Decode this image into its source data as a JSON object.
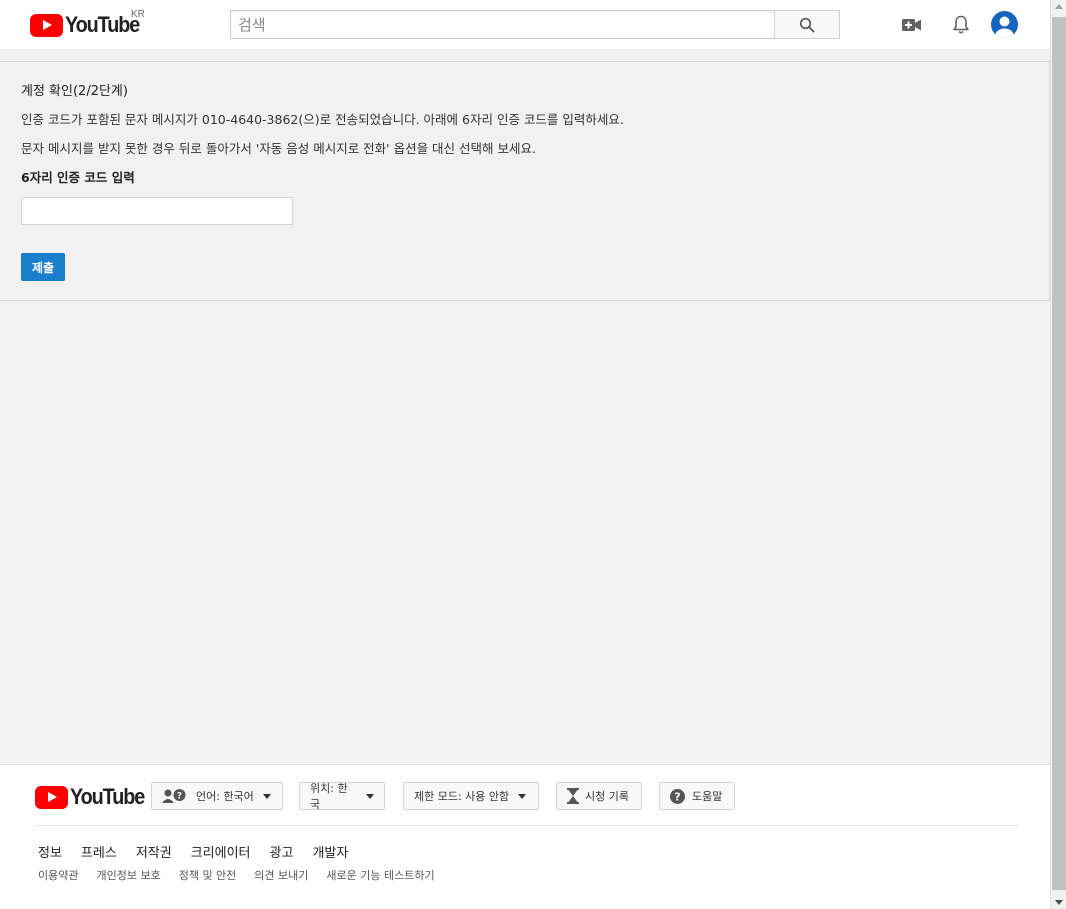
{
  "header": {
    "logo_text": "YouTube",
    "region": "KR",
    "search_placeholder": "검색",
    "icons": [
      "search-icon",
      "video-upload-icon",
      "bell-icon",
      "avatar"
    ]
  },
  "verification": {
    "title": "계정 확인(2/2단계)",
    "message_sent": "인증 코드가 포함된 문자 메시지가 010-4640-3862(으)로 전송되었습니다. 아래에 6자리 인증 코드를 입력하세요.",
    "message_fallback": "문자 메시지를 받지 못한 경우 뒤로 돌아가서 '자동 음성 메시지로 전화' 옵션을 대신 선택해 보세요.",
    "code_label": "6자리 인증 코드 입력",
    "code_value": "",
    "submit_label": "제출"
  },
  "footer": {
    "logo_text": "YouTube",
    "language_label": "언어: 한국어",
    "location_label": "위치: 한국",
    "restricted_label": "제한 모드: 사용 안함",
    "history_label": "시청 기록",
    "help_label": "도움말",
    "primary_links": [
      "정보",
      "프레스",
      "저작권",
      "크리에이터",
      "광고",
      "개발자"
    ],
    "secondary_links": [
      "이용약관",
      "개인정보 보호",
      "정책 및 안전",
      "의견 보내기",
      "새로운 기능 테스트하기"
    ]
  },
  "colors": {
    "brand_red": "#ff0000",
    "submit_blue": "#1b7fcc",
    "avatar_blue": "#1565c0",
    "page_background": "#f1f1f1"
  }
}
